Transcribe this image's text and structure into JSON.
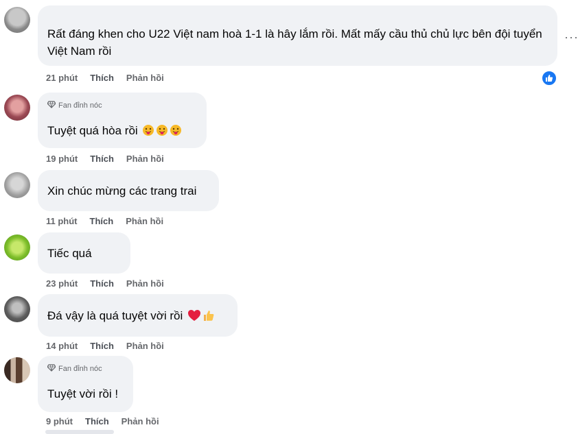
{
  "comments": [
    {
      "text": "Rất đáng khen cho U22 Việt nam hoà 1-1 là hây lắm rồi. Mất mấy cầu thủ chủ lực bên đội tuyển Việt Nam rồi",
      "time": "21 phút",
      "like": "Thích",
      "reply": "Phản hồi"
    },
    {
      "badge": "Fan đỉnh nóc",
      "text": "Tuyệt quá hòa rồi",
      "time": "19 phút",
      "like": "Thích",
      "reply": "Phản hồi"
    },
    {
      "text": "Xin chúc mừng các trang trai",
      "time": "11 phút",
      "like": "Thích",
      "reply": "Phản hồi"
    },
    {
      "text": "Tiếc quá",
      "time": "23 phút",
      "like": "Thích",
      "reply": "Phản hồi"
    },
    {
      "text": "Đá vậy là quá tuyệt vời rồi",
      "time": "14 phút",
      "like": "Thích",
      "reply": "Phản hồi"
    },
    {
      "badge": "Fan đỉnh nóc",
      "text": "Tuyệt vời rồi !",
      "time": "9 phút",
      "like": "Thích",
      "reply": "Phản hồi"
    }
  ],
  "icons": {
    "more": "more-options-icon",
    "reaction": "like-reaction-icon",
    "badge": "diamond-icon",
    "emoji_tongue": "tongue-out-emoji",
    "emoji_heart": "red-heart-emoji",
    "emoji_thumbs": "thumbs-up-emoji"
  },
  "colors": {
    "bubble": "#f0f2f5",
    "meta_text": "#65676b",
    "like_blue": "#1877f2"
  }
}
